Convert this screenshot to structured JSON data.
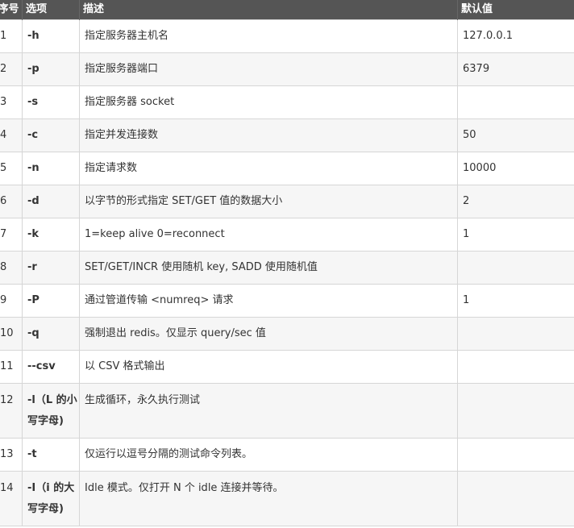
{
  "headers": {
    "num": "序号",
    "option": "选项",
    "description": "描述",
    "default": "默认值"
  },
  "rows": [
    {
      "num": "1",
      "option": "-h",
      "description": "指定服务器主机名",
      "default": "127.0.0.1"
    },
    {
      "num": "2",
      "option": "-p",
      "description": "指定服务器端口",
      "default": "6379"
    },
    {
      "num": "3",
      "option": "-s",
      "description": "指定服务器 socket",
      "default": ""
    },
    {
      "num": "4",
      "option": "-c",
      "description": "指定并发连接数",
      "default": "50"
    },
    {
      "num": "5",
      "option": "-n",
      "description": "指定请求数",
      "default": "10000"
    },
    {
      "num": "6",
      "option": "-d",
      "description": "以字节的形式指定 SET/GET 值的数据大小",
      "default": "2"
    },
    {
      "num": "7",
      "option": "-k",
      "description": "1=keep alive 0=reconnect",
      "default": "1"
    },
    {
      "num": "8",
      "option": "-r",
      "description": "SET/GET/INCR 使用随机 key, SADD 使用随机值",
      "default": ""
    },
    {
      "num": "9",
      "option": "-P",
      "description": "通过管道传输 <numreq> 请求",
      "default": "1"
    },
    {
      "num": "10",
      "option": "-q",
      "description": "强制退出 redis。仅显示 query/sec 值",
      "default": ""
    },
    {
      "num": "11",
      "option": "--csv",
      "description": "以 CSV 格式输出",
      "default": ""
    },
    {
      "num": "12",
      "option": "-l（L 的小写字母)",
      "description": "生成循环，永久执行测试",
      "default": ""
    },
    {
      "num": "13",
      "option": "-t",
      "description": "仅运行以逗号分隔的测试命令列表。",
      "default": ""
    },
    {
      "num": "14",
      "option": "-I（i 的大写字母)",
      "description": "Idle 模式。仅打开 N 个 idle 连接并等待。",
      "default": ""
    }
  ]
}
